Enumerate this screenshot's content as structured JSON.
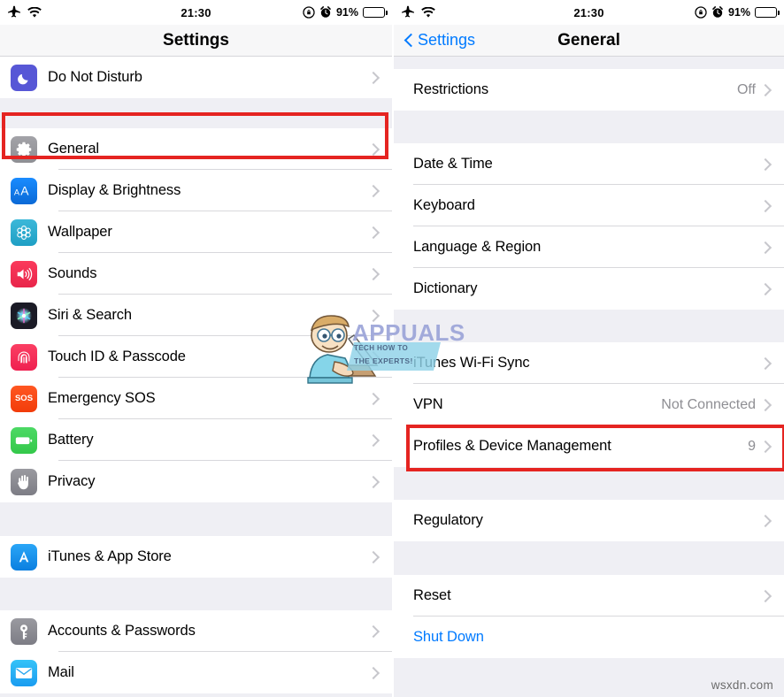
{
  "status_bar": {
    "airplane_icon": "airplane-icon",
    "wifi_icon": "wifi-icon",
    "time": "21:30",
    "rotation_lock_icon": "rotation-lock-icon",
    "alarm_icon": "alarm-icon",
    "battery_percent": "91%",
    "battery_icon": "battery-full-icon"
  },
  "left_panel": {
    "nav": {
      "title": "Settings"
    },
    "groups": [
      {
        "rows": [
          {
            "label": "Do Not Disturb",
            "icon": "moon-icon",
            "icon_class": "ic-dnd",
            "value": "",
            "accessory": "chevron"
          }
        ]
      },
      {
        "rows": [
          {
            "label": "General",
            "icon": "gear-icon",
            "icon_class": "ic-gear",
            "value": "",
            "accessory": "chevron",
            "highlighted": true
          },
          {
            "label": "Display & Brightness",
            "icon": "text-size-icon",
            "icon_class": "ic-display",
            "value": "",
            "accessory": "chevron"
          },
          {
            "label": "Wallpaper",
            "icon": "flower-icon",
            "icon_class": "ic-wall",
            "value": "",
            "accessory": "chevron"
          },
          {
            "label": "Sounds",
            "icon": "speaker-icon",
            "icon_class": "ic-sounds",
            "value": "",
            "accessory": "chevron"
          },
          {
            "label": "Siri & Search",
            "icon": "siri-icon",
            "icon_class": "ic-siri",
            "value": "",
            "accessory": "chevron"
          },
          {
            "label": "Touch ID & Passcode",
            "icon": "fingerprint-icon",
            "icon_class": "ic-touchid",
            "value": "",
            "accessory": "chevron"
          },
          {
            "label": "Emergency SOS",
            "icon": "sos-icon",
            "icon_class": "ic-sos",
            "value": "",
            "accessory": "chevron"
          },
          {
            "label": "Battery",
            "icon": "battery-icon",
            "icon_class": "ic-battery",
            "value": "",
            "accessory": "chevron"
          },
          {
            "label": "Privacy",
            "icon": "hand-icon",
            "icon_class": "ic-privacy",
            "value": "",
            "accessory": "chevron"
          }
        ]
      },
      {
        "rows": [
          {
            "label": "iTunes & App Store",
            "icon": "app-store-icon",
            "icon_class": "ic-appstore",
            "value": "",
            "accessory": "chevron"
          }
        ]
      },
      {
        "rows": [
          {
            "label": "Accounts & Passwords",
            "icon": "key-icon",
            "icon_class": "ic-accounts",
            "value": "",
            "accessory": "chevron"
          },
          {
            "label": "Mail",
            "icon": "envelope-icon",
            "icon_class": "ic-mail",
            "value": "",
            "accessory": "chevron"
          }
        ]
      }
    ]
  },
  "right_panel": {
    "nav": {
      "back_label": "Settings",
      "title": "General",
      "back_icon": "chevron-left-icon"
    },
    "groups": [
      {
        "rows": [
          {
            "label": "Restrictions",
            "value": "Off",
            "accessory": "chevron"
          }
        ]
      },
      {
        "rows": [
          {
            "label": "Date & Time",
            "value": "",
            "accessory": "chevron"
          },
          {
            "label": "Keyboard",
            "value": "",
            "accessory": "chevron"
          },
          {
            "label": "Language & Region",
            "value": "",
            "accessory": "chevron"
          },
          {
            "label": "Dictionary",
            "value": "",
            "accessory": "chevron"
          }
        ]
      },
      {
        "rows": [
          {
            "label": "iTunes Wi-Fi Sync",
            "value": "",
            "accessory": "chevron"
          },
          {
            "label": "VPN",
            "value": "Not Connected",
            "accessory": "chevron"
          },
          {
            "label": "Profiles & Device Management",
            "value": "9",
            "accessory": "chevron",
            "highlighted": true
          }
        ]
      },
      {
        "rows": [
          {
            "label": "Regulatory",
            "value": "",
            "accessory": "chevron"
          }
        ]
      },
      {
        "rows": [
          {
            "label": "Reset",
            "value": "",
            "accessory": "chevron"
          },
          {
            "label": "Shut Down",
            "value": "",
            "accessory": "none",
            "style": "blue"
          }
        ]
      }
    ]
  },
  "watermarks": {
    "appuals_word": "APPUALS",
    "appuals_line1": "TECH HOW TO",
    "appuals_line2": "THE EXPERTS!",
    "site": "wsxdn.com"
  },
  "colors": {
    "highlight": "#e52421",
    "accent_blue": "#007aff",
    "group_background": "#efeff4",
    "row_background": "#ffffff",
    "secondary_text": "#8e8e93"
  }
}
